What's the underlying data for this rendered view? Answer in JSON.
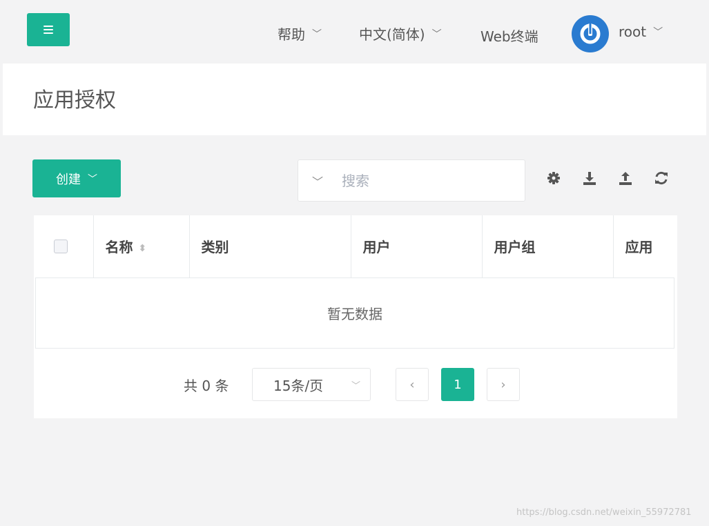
{
  "header": {
    "help": "帮助",
    "language": "中文(简体)",
    "web_terminal": "Web终端",
    "user": "root",
    "chevron": "﹀"
  },
  "page": {
    "title": "应用授权"
  },
  "toolbar": {
    "create_label": "创建",
    "search_placeholder": "搜索"
  },
  "table": {
    "columns": [
      "名称",
      "类别",
      "用户",
      "用户组",
      "应用"
    ],
    "empty_text": "暂无数据"
  },
  "pagination": {
    "total": "共 0 条",
    "per_page": "15条/页",
    "prev": "‹",
    "current_page": "1",
    "next": "›"
  },
  "watermark": "https://blog.csdn.net/weixin_55972781",
  "colors": {
    "accent": "#1ab394",
    "avatar": "#2a7bd0"
  }
}
